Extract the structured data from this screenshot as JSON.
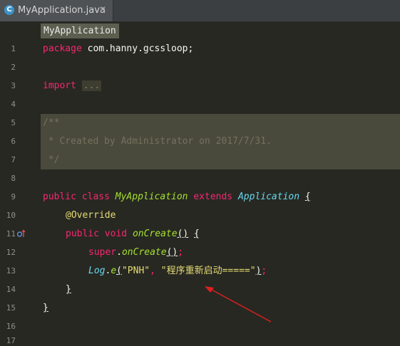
{
  "tab": {
    "icon_letter": "C",
    "label": "MyApplication.java",
    "close": "✕"
  },
  "breadcrumb": "MyApplication",
  "line_numbers": [
    "1",
    "2",
    "3",
    "4",
    "5",
    "6",
    "7",
    "8",
    "9",
    "10",
    "11",
    "12",
    "13",
    "14",
    "15",
    "16",
    "17"
  ],
  "code": {
    "l1": {
      "kw": "package",
      "rest": " com.hanny.gcssloop;"
    },
    "l3": {
      "kw": "import",
      "dots": "..."
    },
    "l6": "/**",
    "l7": " * Created by Administrator on 2017/7/31.",
    "l8": " */",
    "l10": {
      "k1": "public",
      "k2": "class",
      "name": "MyApplication",
      "k3": "extends",
      "parent": "Application",
      "brace": "{"
    },
    "l11": "@Override",
    "l12": {
      "k1": "public",
      "k2": "void",
      "fn": "onCreate",
      "parens": "()",
      "brace": "{"
    },
    "l13": {
      "kw": "super",
      "dot": ".",
      "fn": "onCreate",
      "parens": "()",
      "semi": ";"
    },
    "l14": {
      "cls": "Log",
      "dot": ".",
      "fn": "e",
      "open": "(",
      "s1": "\"PNH\"",
      "comma": ", ",
      "s2": "\"程序重新启动=====\"",
      "close": ")",
      "semi": ";"
    },
    "l15": "}",
    "l16": "}"
  },
  "colors": {
    "background": "#272822",
    "keyword": "#f92672",
    "type": "#66d9ef",
    "function": "#a6e22e",
    "string": "#e6db74",
    "comment": "#75715e",
    "arrow": "#e02020"
  },
  "icons": {
    "override": "override-up-arrow-icon",
    "tab": "java-class-icon"
  }
}
